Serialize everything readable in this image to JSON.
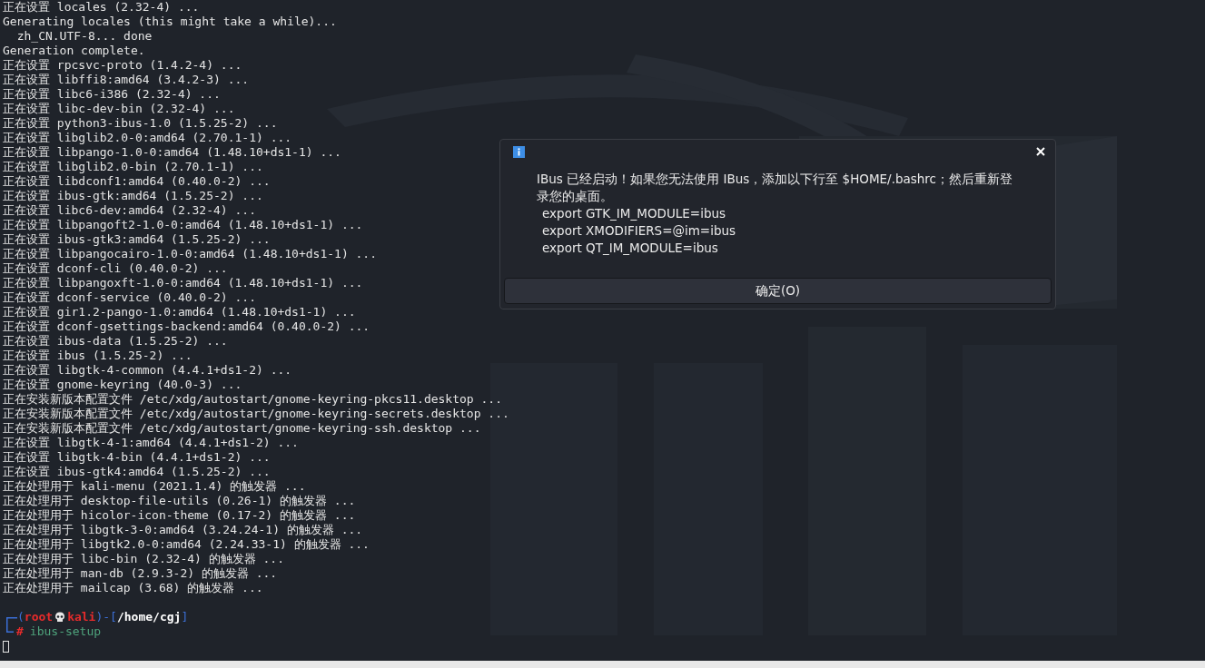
{
  "terminal": {
    "lines": [
      "正在设置 locales (2.32-4) ...",
      "Generating locales (this might take a while)...",
      "  zh_CN.UTF-8... done",
      "Generation complete.",
      "正在设置 rpcsvc-proto (1.4.2-4) ...",
      "正在设置 libffi8:amd64 (3.4.2-3) ...",
      "正在设置 libc6-i386 (2.32-4) ...",
      "正在设置 libc-dev-bin (2.32-4) ...",
      "正在设置 python3-ibus-1.0 (1.5.25-2) ...",
      "正在设置 libglib2.0-0:amd64 (2.70.1-1) ...",
      "正在设置 libpango-1.0-0:amd64 (1.48.10+ds1-1) ...",
      "正在设置 libglib2.0-bin (2.70.1-1) ...",
      "正在设置 libdconf1:amd64 (0.40.0-2) ...",
      "正在设置 ibus-gtk:amd64 (1.5.25-2) ...",
      "正在设置 libc6-dev:amd64 (2.32-4) ...",
      "正在设置 libpangoft2-1.0-0:amd64 (1.48.10+ds1-1) ...",
      "正在设置 ibus-gtk3:amd64 (1.5.25-2) ...",
      "正在设置 libpangocairo-1.0-0:amd64 (1.48.10+ds1-1) ...",
      "正在设置 dconf-cli (0.40.0-2) ...",
      "正在设置 libpangoxft-1.0-0:amd64 (1.48.10+ds1-1) ...",
      "正在设置 dconf-service (0.40.0-2) ...",
      "正在设置 gir1.2-pango-1.0:amd64 (1.48.10+ds1-1) ...",
      "正在设置 dconf-gsettings-backend:amd64 (0.40.0-2) ...",
      "正在设置 ibus-data (1.5.25-2) ...",
      "正在设置 ibus (1.5.25-2) ...",
      "正在设置 libgtk-4-common (4.4.1+ds1-2) ...",
      "正在设置 gnome-keyring (40.0-3) ...",
      "正在安装新版本配置文件 /etc/xdg/autostart/gnome-keyring-pkcs11.desktop ...",
      "正在安装新版本配置文件 /etc/xdg/autostart/gnome-keyring-secrets.desktop ...",
      "正在安装新版本配置文件 /etc/xdg/autostart/gnome-keyring-ssh.desktop ...",
      "正在设置 libgtk-4-1:amd64 (4.4.1+ds1-2) ...",
      "正在设置 libgtk-4-bin (4.4.1+ds1-2) ...",
      "正在设置 ibus-gtk4:amd64 (1.5.25-2) ...",
      "正在处理用于 kali-menu (2021.1.4) 的触发器 ...",
      "正在处理用于 desktop-file-utils (0.26-1) 的触发器 ...",
      "正在处理用于 hicolor-icon-theme (0.17-2) 的触发器 ...",
      "正在处理用于 libgtk-3-0:amd64 (3.24.24-1) 的触发器 ...",
      "正在处理用于 libgtk2.0-0:amd64 (2.24.33-1) 的触发器 ...",
      "正在处理用于 libc-bin (2.32-4) 的触发器 ...",
      "正在处理用于 man-db (2.9.3-2) 的触发器 ...",
      "正在处理用于 mailcap (3.68) 的触发器 ..."
    ],
    "prompt": {
      "open": "(",
      "user": "root",
      "mid": ")-[",
      "close": "]",
      "host": "kali",
      "path": "/home/cgj",
      "symbol": "#",
      "command": "ibus-setup"
    }
  },
  "dialog": {
    "message": "IBus 已经启动！如果您无法使用 IBus，添加以下行至 $HOME/.bashrc；然后重新登录您的桌面。",
    "exports": [
      "export GTK_IM_MODULE=ibus",
      "export XMODIFIERS=@im=ibus",
      "export QT_IM_MODULE=ibus"
    ],
    "button": "确定(O)"
  }
}
